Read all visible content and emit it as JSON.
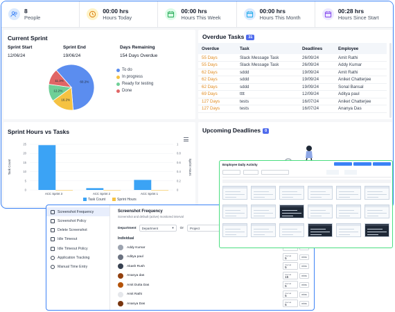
{
  "stats": [
    {
      "value": "8",
      "label": "People",
      "color": "#dbeafe",
      "icon": "people-icon"
    },
    {
      "value": "00:00 hrs",
      "label": "Hours Today",
      "color": "#fef3c7",
      "icon": "clock-icon"
    },
    {
      "value": "00:00 hrs",
      "label": "Hours This Week",
      "color": "#dcfce7",
      "icon": "calendar-week-icon"
    },
    {
      "value": "00:00 hrs",
      "label": "Hours This Month",
      "color": "#dbeafe",
      "icon": "calendar-month-icon"
    },
    {
      "value": "00:28 hrs",
      "label": "Hours Since Start",
      "color": "#ede9fe",
      "icon": "calendar-start-icon"
    }
  ],
  "current_sprint": {
    "title": "Current Sprint",
    "start_label": "Sprint Start",
    "start_value": "12/06/24",
    "end_label": "Sprint End",
    "end_value": "19/06/24",
    "remaining_label": "Days Remaining",
    "remaining_value": "154 Days Overdue",
    "pie": [
      {
        "label": "To do",
        "percent": 60.2,
        "color": "#5b8def"
      },
      {
        "label": "In progress",
        "percent": 16.2,
        "color": "#f5c242"
      },
      {
        "label": "Ready for testing",
        "percent": 12.2,
        "color": "#6fcf97"
      },
      {
        "label": "Done",
        "percent": 11.3,
        "color": "#e06666"
      }
    ],
    "pie_labels": [
      "60.2%",
      "16.2%",
      "12.2%",
      "11.3%"
    ]
  },
  "overdue": {
    "title": "Overdue Tasks",
    "count": "31",
    "columns": [
      "Overdue",
      "Task",
      "Deadlines",
      "Employee"
    ],
    "rows": [
      [
        "55 Days",
        "Slack Message Task",
        "26/09/24",
        "Amit Rathi"
      ],
      [
        "55 Days",
        "Slack Message Task",
        "26/09/24",
        "Addy Kumar"
      ],
      [
        "62 Days",
        "sddd",
        "19/09/24",
        "Amit Rathi"
      ],
      [
        "62 Days",
        "sddd",
        "19/09/24",
        "Aniket Chatterjee"
      ],
      [
        "62 Days",
        "sddd",
        "19/09/24",
        "Sonal Bansal"
      ],
      [
        "69 Days",
        "tttt",
        "12/09/24",
        "Aditya paul"
      ],
      [
        "127 Days",
        "tests",
        "16/07/24",
        "Aniket Chatterjee"
      ],
      [
        "127 Days",
        "tests",
        "16/07/24",
        "Ananya Das"
      ]
    ]
  },
  "sprint_hours": {
    "title": "Sprint Hours vs Tasks",
    "ylabel_left": "Task Count",
    "ylabel_right": "Sprint Hours",
    "legend": [
      "Task Count",
      "Sprint Hours"
    ]
  },
  "chart_data": {
    "type": "bar",
    "categories": [
      "ACC Sprint 3",
      "ACC Sprint 2",
      "ACC Sprint 1"
    ],
    "series": [
      {
        "name": "Task Count",
        "values": [
          24.5,
          1,
          5.5
        ],
        "color": "#3ba3f5"
      },
      {
        "name": "Sprint Hours",
        "values": [
          0,
          0,
          0
        ],
        "color": "#f5c242"
      }
    ],
    "ylim": [
      0,
      25
    ],
    "yticks": [
      "25",
      "20",
      "15",
      "10",
      "5",
      "0"
    ],
    "ylim_right": [
      0,
      1
    ],
    "yticks_right": [
      "1",
      "0.8",
      "0.6",
      "0.4",
      "0.2",
      "0"
    ],
    "ylabel": "Task Count",
    "ylabel_right": "Sprint Hours"
  },
  "upcoming": {
    "title": "Upcoming Deadlines",
    "count": "0"
  },
  "settings": {
    "menu": [
      "Screenshot Frequency",
      "Screenshot Policy",
      "Delete Screenshot",
      "Idle Timeout",
      "Idle Timeout Policy",
      "Application Tracking",
      "Manual Time Entry"
    ],
    "title": "Screenshot Frequency",
    "subtitle": "Screenshot and default (active) monitored interval",
    "department_label": "Department",
    "department_value": "Department",
    "or_label": "Or",
    "project_value": "Project",
    "individual_label": "Individual",
    "interval_label": "Interval",
    "unit": "mins",
    "users": [
      {
        "name": "Addy Kumar",
        "value": "",
        "color": "#9ca3af"
      },
      {
        "name": "Aditya paul",
        "value": "5",
        "color": "#6b7280"
      },
      {
        "name": "Akash Rush",
        "value": "5",
        "color": "#374151"
      },
      {
        "name": "Ananya das",
        "value": "15",
        "color": "#92400e"
      },
      {
        "name": "Amit Dutta Das",
        "value": "5",
        "color": "#b45309"
      },
      {
        "name": "Amit Rathi",
        "value": "5",
        "color": "#e5e7eb"
      },
      {
        "name": "Ananya Das",
        "value": "5",
        "color": "#78350f"
      }
    ]
  },
  "activity": {
    "title": "Employee Daily Activity"
  }
}
